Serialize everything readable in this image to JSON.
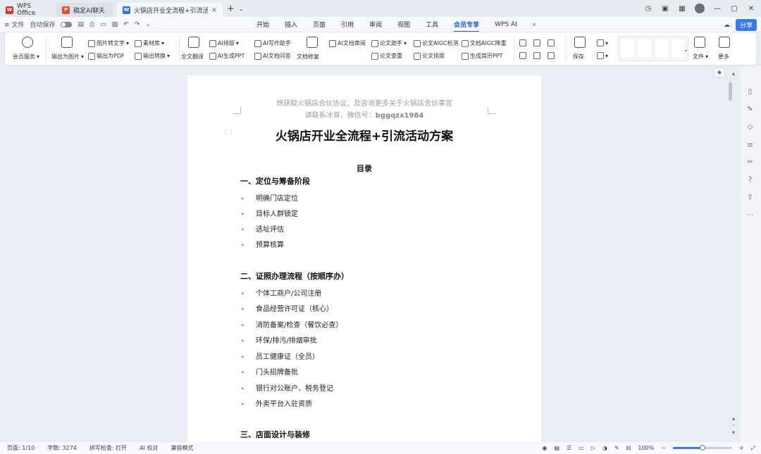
{
  "titlebar": {
    "tabs": [
      {
        "label": "WPS Office",
        "logo": "W",
        "color": "#d93025"
      },
      {
        "label": "稿定AI聊天",
        "logo": "P",
        "color": "#e34a3a"
      },
      {
        "label": "火锅店开业全流程+引流活动方案...",
        "logo": "W",
        "color": "#2f6fe0",
        "close": "×"
      }
    ],
    "plus": "+",
    "chevron": "⌄"
  },
  "menubar": {
    "file_label": "≡ 文件",
    "auto_save": "自动保存",
    "tabs": [
      "开始",
      "插入",
      "页面",
      "引用",
      "审阅",
      "视图",
      "工具",
      "会员专享",
      "WPS AI"
    ],
    "active_tab": "会员专享",
    "share_label": "分享"
  },
  "ribbon": {
    "items": [
      {
        "label": "会员服务",
        "caret": "▾"
      },
      {
        "label": "输出为图片",
        "caret": "▾"
      },
      {
        "label": "图片转文字",
        "caret": "▾"
      },
      {
        "label": "输出为PDF"
      },
      {
        "label": "素材库",
        "caret": "▾"
      },
      {
        "label": "输出转换",
        "caret": "▾"
      },
      {
        "label": "全文翻译"
      },
      {
        "label": "AI排版",
        "caret": "▾"
      },
      {
        "label": "AI生成PPT"
      },
      {
        "label": "AI文档问答"
      },
      {
        "label": "AI写作助手"
      },
      {
        "label": "文档修复"
      },
      {
        "label": "AI文档审阅"
      },
      {
        "label": "论文助手",
        "caret": "▾"
      },
      {
        "label": "论文查重"
      },
      {
        "label": "论文AIGC检测"
      },
      {
        "label": "论文排版"
      },
      {
        "label": "文档AIGC降重"
      },
      {
        "label": "生成简历PPT"
      },
      {
        "label": "保存"
      },
      {
        "label": "文件"
      },
      {
        "label": "更多"
      }
    ]
  },
  "document": {
    "watermark_line1": "想获取火锅店合伙协议，及咨询更多关于火锅店合伙事宜",
    "watermark_line2": "请联系冰哥，微信号：",
    "watermark_wechat": "bggqzx1984",
    "title": "火锅店开业全流程+引流活动方案",
    "toc_title": "目录",
    "sections": [
      {
        "heading": "一、定位与筹备阶段",
        "items": [
          "明确门店定位",
          "目标人群锁定",
          "选址评估",
          "预算核算"
        ]
      },
      {
        "heading": "二、证照办理流程（按顺序办）",
        "items": [
          "个体工商户/公司注册",
          "食品经营许可证（核心）",
          "消防备案/检查（餐饮必查）",
          "环保/排污/排烟审批",
          "员工健康证（全员）",
          "门头招牌备批",
          "银行对公账户、税务登记",
          "外卖平台入驻资质"
        ]
      },
      {
        "heading": "三、店面设计与装修",
        "items": []
      }
    ],
    "bullet": "•"
  },
  "statusbar": {
    "page": "页面: 1/10",
    "words": "字数: 3274",
    "spell": "拼写检查: 打开",
    "ai_check": "AI 校对",
    "compat": "兼容模式",
    "zoom": "100%",
    "zoom_minus": "−",
    "zoom_plus": "+",
    "zoom_fraction": 0.5
  },
  "colors": {
    "accent": "#1e5fe0",
    "bullet": "#3a6fd8",
    "share": "#3a7af0"
  }
}
